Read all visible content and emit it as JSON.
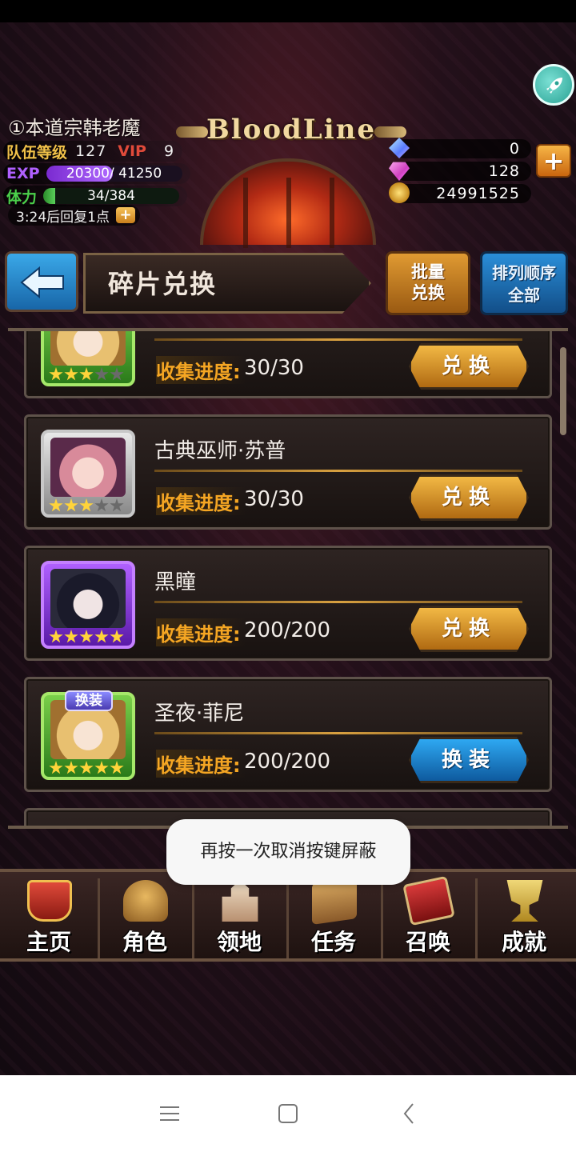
{
  "player": {
    "name": "①本道宗韩老魔",
    "team_level_label": "队伍等级",
    "team_level": "127",
    "vip_label": "VIP",
    "vip": "9",
    "exp_label": "EXP",
    "exp_text": "20300/ 41250",
    "exp_progress": 0.49,
    "stamina_label": "体力",
    "stamina_text": "34/384",
    "stamina_progress": 0.09,
    "recover_text": "3:24后回复1点"
  },
  "logo_text": "BloodLine",
  "currency": {
    "crystal": "0",
    "gem": "128",
    "gold": "24991525"
  },
  "page": {
    "title": "碎片兑换",
    "batch_line1": "批量",
    "batch_line2": "兑换",
    "sort_line1": "排列顺序",
    "sort_line2": "全部"
  },
  "cards": [
    {
      "name": "",
      "progress_label": "收集进度:",
      "progress": "30/30",
      "action": "兑换",
      "stars_on": 3,
      "frame": "green"
    },
    {
      "name": "古典巫师·苏普",
      "progress_label": "收集进度:",
      "progress": "30/30",
      "action": "兑换",
      "stars_on": 3,
      "frame": "silver"
    },
    {
      "name": "黑瞳",
      "progress_label": "收集进度:",
      "progress": "200/200",
      "action": "兑换",
      "stars_on": 5,
      "frame": "purple"
    },
    {
      "name": "圣夜·菲尼",
      "progress_label": "收集进度:",
      "progress": "200/200",
      "action": "换装",
      "stars_on": 5,
      "frame": "green",
      "badge": "换装"
    }
  ],
  "nav": [
    "主页",
    "角色",
    "领地",
    "任务",
    "召唤",
    "成就"
  ],
  "toast": "再按一次取消按键屏蔽",
  "colors": {
    "accent_gold": "#f5a623",
    "exchange_button": "#d08a22",
    "swap_button": "#1e80c8",
    "vip_red": "#e04a3a",
    "exp_purple": "#b060ff",
    "stamina_green": "#4bd04b"
  }
}
